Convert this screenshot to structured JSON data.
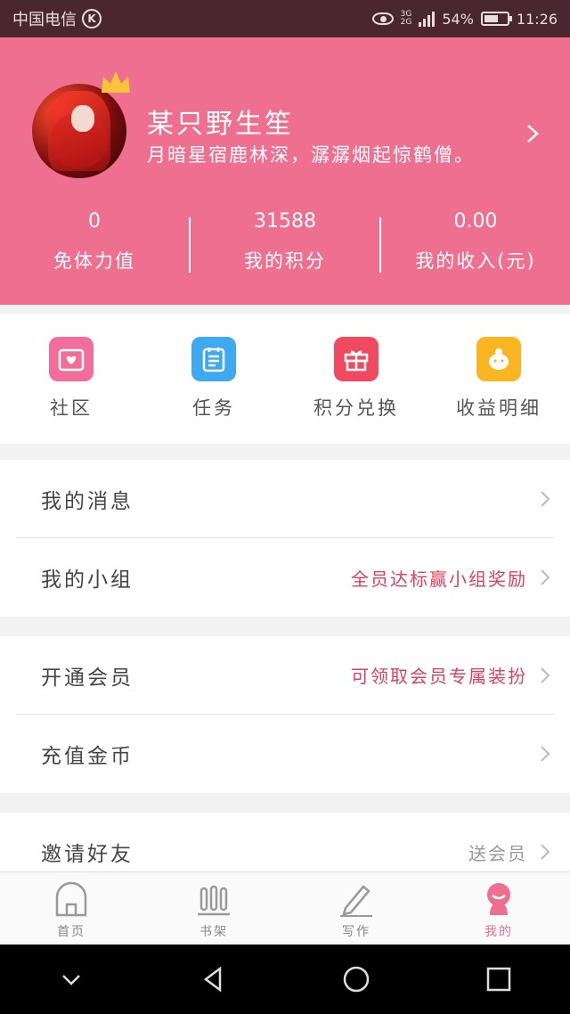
{
  "status_bar": {
    "carrier": "中国电信",
    "carrier_badge": "K",
    "network_top": "3G",
    "network_bottom": "2G",
    "battery": "54%",
    "time": "11:26"
  },
  "profile": {
    "username": "某只野生笙",
    "motto": "月暗星宿鹿林深，潺潺烟起惊鹤僧。",
    "stats": [
      {
        "value": "0",
        "label": "免体力值"
      },
      {
        "value": "31588",
        "label": "我的积分"
      },
      {
        "value": "0.00",
        "label": "我的收入(元)"
      }
    ]
  },
  "actions": [
    {
      "label": "社区",
      "icon": "community-icon",
      "color": "#f36d9b"
    },
    {
      "label": "任务",
      "icon": "task-icon",
      "color": "#3fa9f0"
    },
    {
      "label": "积分兑换",
      "icon": "gift-icon",
      "color": "#ef4a61"
    },
    {
      "label": "收益明细",
      "icon": "piggy-icon",
      "color": "#f9b621"
    }
  ],
  "groups": [
    {
      "rows": [
        {
          "title": "我的消息",
          "hint": ""
        },
        {
          "title": "我的小组",
          "hint": "全员达标赢小组奖励"
        }
      ]
    },
    {
      "rows": [
        {
          "title": "开通会员",
          "hint": "可领取会员专属装扮"
        },
        {
          "title": "充值金币",
          "hint": ""
        }
      ]
    },
    {
      "rows": [
        {
          "title": "邀请好友",
          "hint": "送会员"
        }
      ]
    }
  ],
  "tabs": [
    {
      "label": "首页",
      "icon": "home-icon"
    },
    {
      "label": "书架",
      "icon": "bookshelf-icon"
    },
    {
      "label": "写作",
      "icon": "pencil-icon"
    },
    {
      "label": "我的",
      "icon": "profile-icon",
      "active": true
    }
  ],
  "colors": {
    "accent": "#ee6f8f",
    "hint_red": "#e0405e"
  }
}
